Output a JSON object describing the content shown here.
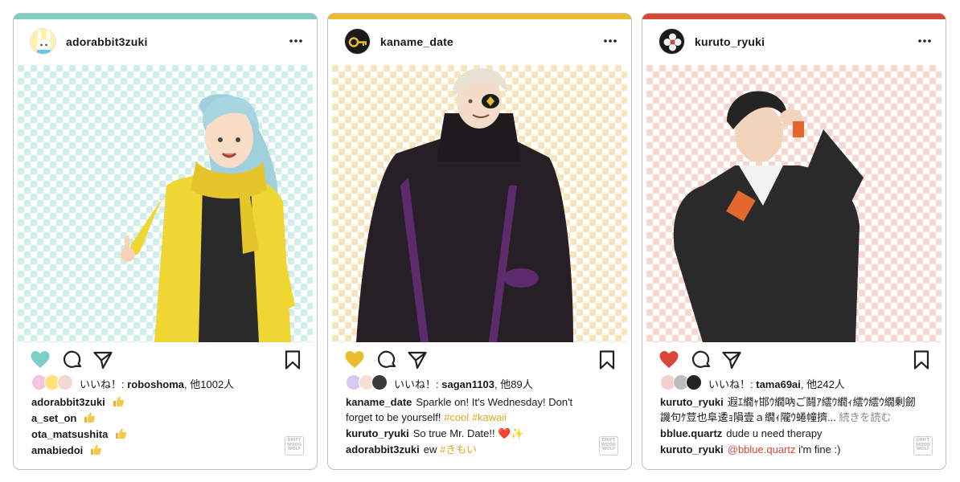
{
  "colors": {
    "card1_accent": "#7ccfc4",
    "card2_accent": "#ecbc2c",
    "card3_accent": "#d8473a"
  },
  "posts": [
    {
      "username": "adorabbit3zuki",
      "avatar_icon": "rabbit-mascot",
      "heart_color": "#7ccfc4",
      "likes_prefix": "いいね！: ",
      "likes_user": "roboshoma",
      "likes_suffix": ", 他1002人",
      "comments": [
        {
          "user": "adorabbit3zuki",
          "text": "",
          "emoji": "thumbs-up"
        },
        {
          "user": "a_set_on",
          "text": "",
          "emoji": "thumbs-up"
        },
        {
          "user": "ota_matsushita",
          "text": "",
          "emoji": "thumbs-up"
        },
        {
          "user": "amabiedoi",
          "text": "",
          "emoji": "thumbs-up"
        }
      ],
      "watermark": "DRIFT WOOD WOLF"
    },
    {
      "username": "kaname_date",
      "avatar_icon": "key",
      "heart_color": "#ecbc2c",
      "likes_prefix": "いいね！: ",
      "likes_user": "sagan1103",
      "likes_suffix": ", 他89人",
      "comments": [
        {
          "user": "kaname_date",
          "text": "Sparkle on! It's Wednesday! Don't forget to be yourself!",
          "tags": "#cool #kawaii"
        },
        {
          "user": "kuruto_ryuki",
          "text": "So true Mr. Date!! ❤️✨"
        },
        {
          "user": "adorabbit3zuki",
          "text": "ew",
          "tags": "#きもい"
        }
      ],
      "watermark": "DRIFT WOOD WOLF"
    },
    {
      "username": "kuruto_ryuki",
      "avatar_icon": "flower",
      "heart_color": "#d8473a",
      "likes_prefix": "いいね！: ",
      "likes_user": "tama69ai",
      "likes_suffix": ", 他242人",
      "comments": [
        {
          "user": "kuruto_ryuki",
          "text": "遐ｴ繝ｬ邯ｳ繝吶ご鬪ｱ繧ｳ繝ｨ繧ｳ繧ｳ繝剰劒譏句ｹ荳也阜逶ｮ隕壹ａ繝ｨ隴ｳ蜷幢擠...",
          "more": "続きを読む"
        },
        {
          "user": "bblue.quartz",
          "text": "dude u need therapy"
        },
        {
          "user": "kuruto_ryuki",
          "mention": "@bblue.quartz",
          "text": "i'm fine :)"
        }
      ],
      "watermark": "DRIFT WOOD WOLF"
    }
  ]
}
